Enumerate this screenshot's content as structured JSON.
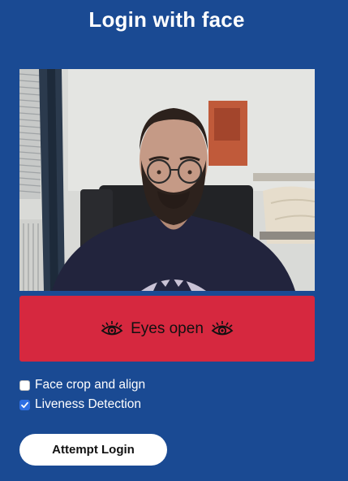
{
  "page": {
    "title": "Login with face"
  },
  "camera": {
    "icon": "webcam-feed"
  },
  "status": {
    "label": "Eyes open",
    "icon": "eye-icon",
    "color": "#d6283f"
  },
  "options": [
    {
      "label": "Face crop and align",
      "checked": false
    },
    {
      "label": "Liveness Detection",
      "checked": true
    }
  ],
  "actions": {
    "login_label": "Attempt Login"
  },
  "colors": {
    "background": "#1a4a93",
    "checkbox_checked": "#2e6fe3"
  }
}
